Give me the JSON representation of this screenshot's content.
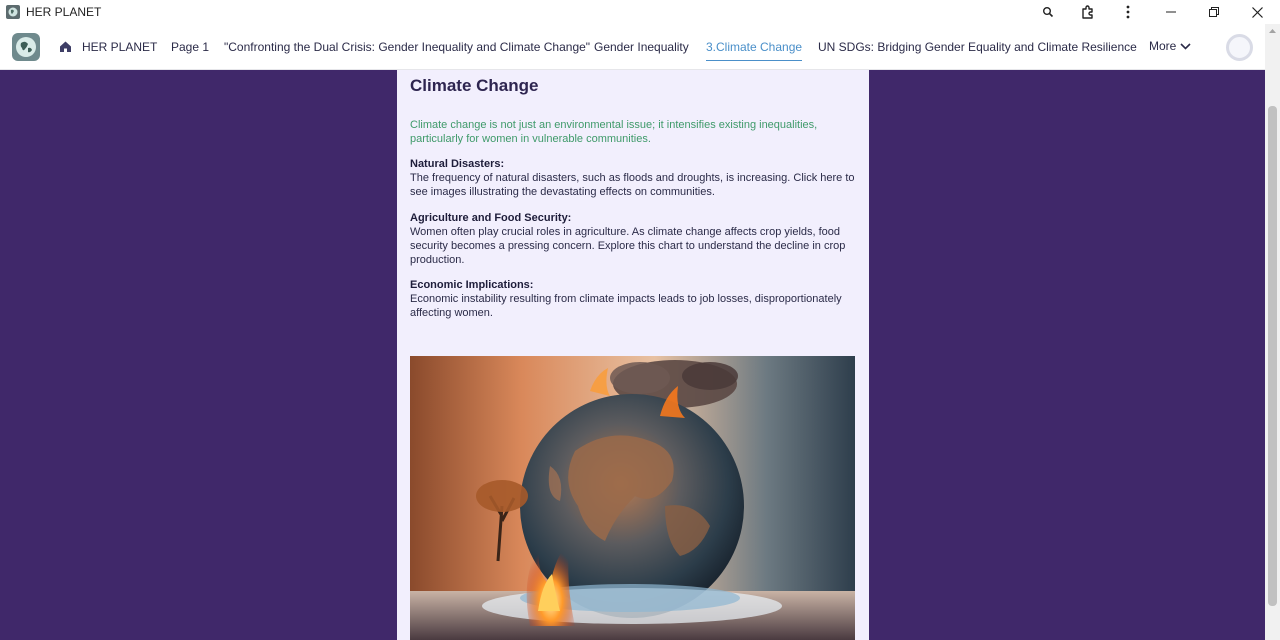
{
  "window": {
    "title": "HER PLANET"
  },
  "nav": {
    "items": [
      {
        "label": "HER PLANET"
      },
      {
        "label": "Page 1"
      },
      {
        "label": "\"Confronting the Dual Crisis: Gender Inequality and Climate Change\""
      },
      {
        "label": "Gender Inequality"
      },
      {
        "label": "3.Climate Change",
        "active": true
      },
      {
        "label": "UN SDGs: Bridging Gender Equality and Climate Resilience"
      }
    ],
    "more_label": "More"
  },
  "content": {
    "title": "Climate Change",
    "intro": "Climate change is not just an environmental issue; it intensifies existing inequalities, particularly for women in vulnerable communities.",
    "sections": [
      {
        "heading": "Natural Disasters:",
        "body": "The frequency of natural disasters, such as floods and droughts, is increasing. Click here to see images illustrating the devastating effects on communities."
      },
      {
        "heading": "Agriculture and Food Security:",
        "body": "Women often play crucial roles in agriculture. As climate change affects crop yields, food security becomes a pressing concern. Explore this chart to understand the decline in crop production."
      },
      {
        "heading": "Economic Implications:",
        "body": "Economic instability resulting from climate impacts leads to job losses, disproportionately affecting women."
      }
    ]
  },
  "colors": {
    "page_background": "#40286a",
    "card_background": "#f2effd",
    "active_tab": "#4a8fc9",
    "intro_text": "#3f9a6a"
  },
  "icons": {
    "titlebar": [
      "zoom-icon",
      "extensions-icon",
      "kebab-menu-icon",
      "minimize-icon",
      "restore-icon",
      "close-icon"
    ],
    "nav": [
      "site-logo",
      "home-icon",
      "chevron-down-icon",
      "user-avatar"
    ]
  }
}
